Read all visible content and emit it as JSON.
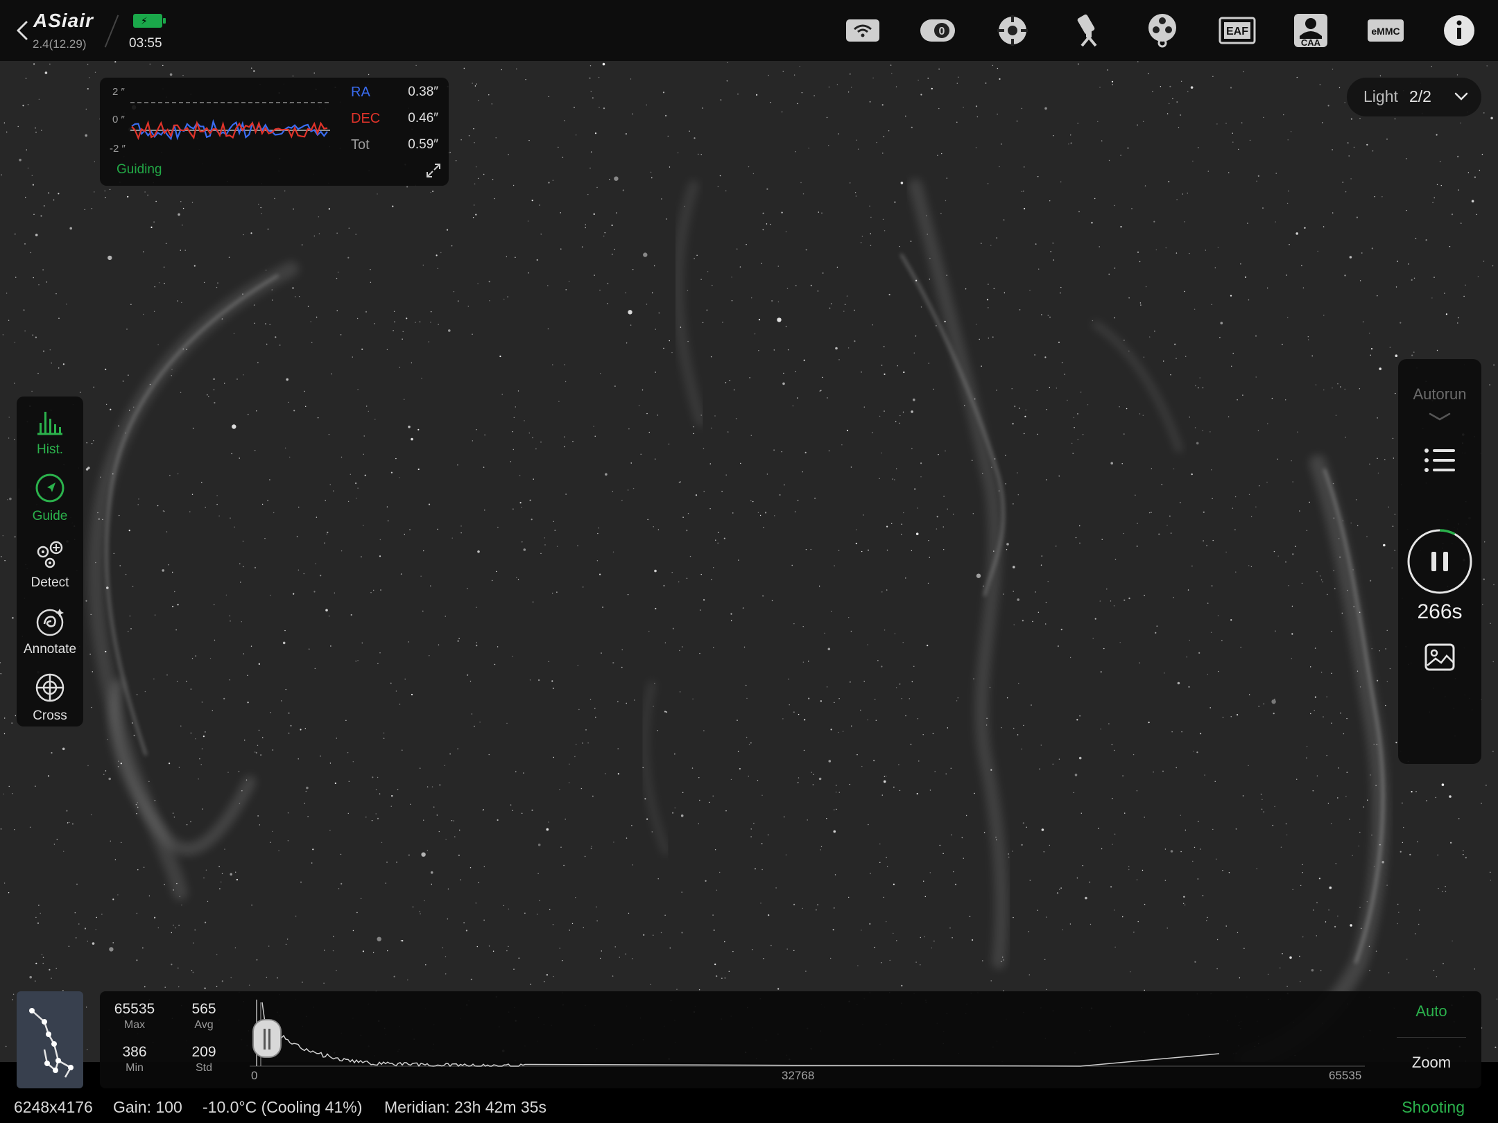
{
  "app": {
    "logo": "ASiair",
    "version": "2.4(12.29)",
    "time": "03:55",
    "battery_color": "#1aa84a"
  },
  "top_icons": [
    {
      "name": "wifi-router-icon",
      "text": ""
    },
    {
      "name": "camera-icon",
      "text": ""
    },
    {
      "name": "guide-scope-icon",
      "text": ""
    },
    {
      "name": "telescope-mount-icon",
      "text": ""
    },
    {
      "name": "filter-wheel-icon",
      "text": ""
    },
    {
      "name": "eaf-focuser-icon",
      "text": "EAF"
    },
    {
      "name": "caa-rotator-icon",
      "text": "CAA"
    },
    {
      "name": "emmc-storage-icon",
      "text": "eMMC"
    },
    {
      "name": "info-icon",
      "text": ""
    }
  ],
  "guiding": {
    "y_ticks": [
      "2 ″",
      "0 ″",
      "-2 ″"
    ],
    "ra_label": "RA",
    "ra_value": "0.38″",
    "dec_label": "DEC",
    "dec_value": "0.46″",
    "tot_label": "Tot",
    "tot_value": "0.59″",
    "status": "Guiding",
    "ra_color": "#3a6cf0",
    "dec_color": "#e0332a"
  },
  "frame": {
    "type": "Light",
    "count": "2/2"
  },
  "left_tools": [
    {
      "label": "Hist.",
      "active": true
    },
    {
      "label": "Guide",
      "active": true
    },
    {
      "label": "Detect",
      "active": false
    },
    {
      "label": "Annotate",
      "active": false
    },
    {
      "label": "Cross",
      "active": false
    }
  ],
  "autorun": {
    "label": "Autorun",
    "exposure_remaining": "266s",
    "progress": 0.08
  },
  "histogram": {
    "max_value": "65535",
    "max_label": "Max",
    "avg_value": "565",
    "avg_label": "Avg",
    "min_value": "386",
    "min_label": "Min",
    "std_value": "209",
    "std_label": "Std",
    "axis_min": "0",
    "axis_mid": "32768",
    "axis_max": "65535",
    "auto_label": "Auto",
    "zoom_label": "Zoom"
  },
  "status_bar": {
    "resolution": "6248x4176",
    "gain": "Gain: 100",
    "temperature": "-10.0°C (Cooling 41%)",
    "meridian": "Meridian: 23h 42m 35s",
    "state": "Shooting"
  },
  "colors": {
    "accent_green": "#2bb24c",
    "sky_background": "#262626"
  }
}
